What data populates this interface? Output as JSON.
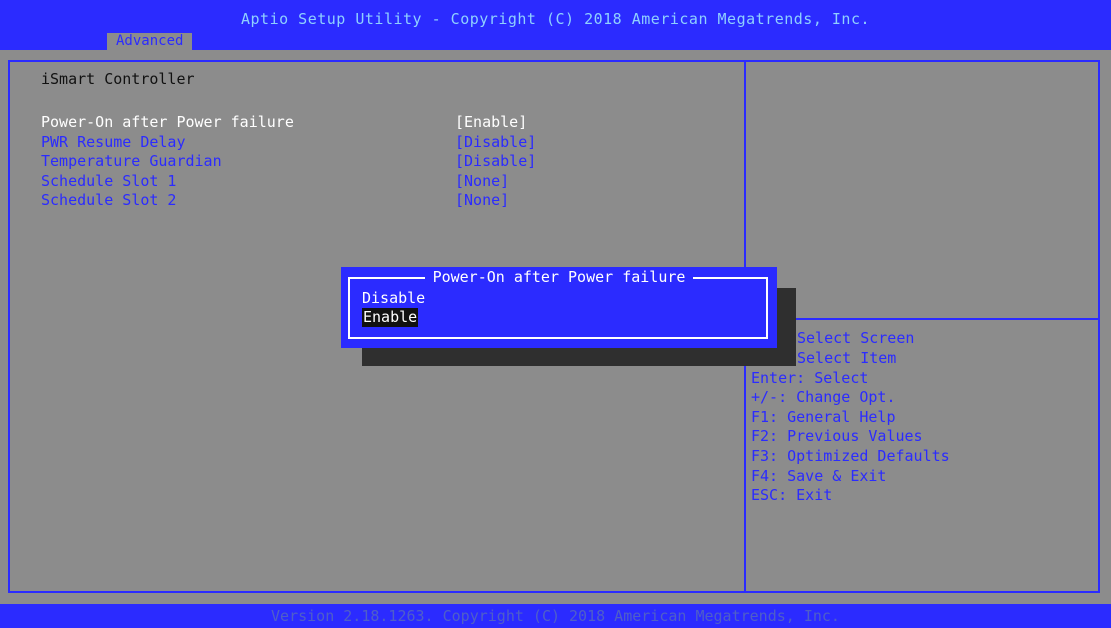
{
  "header": {
    "title": "Aptio Setup Utility - Copyright (C) 2018 American Megatrends, Inc.",
    "active_tab": "Advanced"
  },
  "section_title": "iSmart Controller",
  "settings": [
    {
      "label": "Power-On after Power failure",
      "value": "[Enable]"
    },
    {
      "label": "PWR Resume Delay",
      "value": "[Disable]"
    },
    {
      "label": "Temperature Guardian",
      "value": "[Disable]"
    },
    {
      "label": "Schedule Slot 1",
      "value": "[None]"
    },
    {
      "label": "Schedule Slot 2",
      "value": "[None]"
    }
  ],
  "popup": {
    "title": "Power-On after Power failure",
    "options": [
      "Disable",
      "Enable"
    ],
    "selected": "Enable"
  },
  "help": [
    "Select Screen",
    "Select Item",
    "Enter: Select",
    "+/-: Change Opt.",
    "F1: General Help",
    "F2: Previous Values",
    "F3: Optimized Defaults",
    "F4: Save & Exit",
    "ESC: Exit"
  ],
  "footer": "Version 2.18.1263. Copyright (C) 2018 American Megatrends, Inc.",
  "colors": {
    "background": "#8c8c8c",
    "accent_blue": "#2b2bff",
    "highlight_text": "#ffffff"
  }
}
